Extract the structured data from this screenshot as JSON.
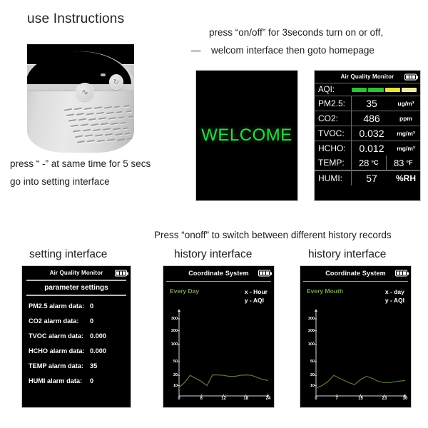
{
  "page": {
    "heading": "use Instructions",
    "instruction_press_line1": "press      “ -” at same time for 5 secs",
    "instruction_press_line2": "go into setting interface",
    "onoff_line1": "press   “on/off”  for 3seconds  turn on or off,",
    "onoff_line2": "welcom  interface  then    goto homepage",
    "onoff_dash": "—",
    "switch_note": "Press   “onoff”   to switch between different history records",
    "caption_setting": "setting interface",
    "caption_history_day": "history  interface",
    "caption_history_month": "history interface"
  },
  "device": {
    "button_left_glyph": "∿",
    "button_right_glyph": "↻"
  },
  "welcome_screen": {
    "text": "WELCOME",
    "color": "#35d24a"
  },
  "monitor_screen": {
    "title": "Air Quality Monitor",
    "aqi": {
      "label": "AQI:",
      "segments": [
        "#2fbf3a",
        "#2fbf3a",
        "#e8e046",
        "#efe9a8"
      ]
    },
    "rows": [
      {
        "label": "PM2.5:",
        "value": "35",
        "unit": "ug/m³"
      },
      {
        "label": "CO2:",
        "value": "486",
        "unit": "ppm"
      },
      {
        "label": "TVOC:",
        "value": "0.032",
        "unit": "mg/m³"
      },
      {
        "label": "HCHO:",
        "value": "0.012",
        "unit": "mg/m³"
      }
    ],
    "temp": {
      "label": "TEMP:",
      "c_value": "28",
      "c_unit": "°C",
      "f_value": "83",
      "f_unit": "°F"
    },
    "humi": {
      "label": "HUMI:",
      "value": "57",
      "unit": "%RH"
    }
  },
  "setting_screen": {
    "title": "Air Quality Monitor",
    "subtitle": "parameter settings",
    "items": [
      {
        "key": "PM2.5 alarm data:",
        "value": "0"
      },
      {
        "key": "CO2 alarm data:",
        "value": "0"
      },
      {
        "key": "TVOC alarm data:",
        "value": "0.000"
      },
      {
        "key": "HCHO alarm data:",
        "value": "0.000"
      },
      {
        "key": "TEMP alarm data:",
        "value": "35"
      },
      {
        "key": "HUMI alarm data:",
        "value": "0"
      }
    ]
  },
  "history_day_screen": {
    "title": "Coordinate System",
    "period": "Every Day",
    "axis_x_label": "x - Hour",
    "axis_y_label": "y - AQI"
  },
  "history_month_screen": {
    "title": "Coordinate System",
    "period": "Every Mouth",
    "axis_x_label": "x - day",
    "axis_y_label": "y - AQI"
  },
  "chart_data": [
    {
      "type": "line",
      "title": "Coordinate System",
      "subtitle": "Every Day",
      "xlabel": "x - Hour",
      "ylabel": "y - AQI",
      "line_color": "#5d7a3e",
      "xticks": [
        "0",
        "6",
        "12",
        "18",
        "24"
      ],
      "xtick_values": [
        0,
        6,
        12,
        18,
        24
      ],
      "yticks": [
        "10",
        "20",
        "50",
        "100",
        "200",
        "300"
      ],
      "ytick_values": [
        10,
        20,
        50,
        100,
        200,
        300
      ],
      "xlim": [
        0,
        24
      ],
      "grid": false,
      "x": [
        0,
        1.5,
        3,
        4.5,
        6,
        7.5,
        9,
        10.5,
        12,
        13.5,
        15,
        16.5,
        18,
        19.5,
        21,
        22.5,
        24
      ],
      "y": [
        8,
        13,
        20,
        17,
        14,
        10,
        21,
        21,
        20,
        19,
        19,
        20,
        21,
        20,
        18,
        16,
        15
      ]
    },
    {
      "type": "line",
      "title": "Coordinate System",
      "subtitle": "Every Mouth",
      "xlabel": "x - day",
      "ylabel": "y - AQI",
      "line_color": "#5d7a3e",
      "xticks": [
        "0",
        "7",
        "15",
        "23",
        "30"
      ],
      "xtick_values": [
        0,
        7,
        15,
        23,
        30
      ],
      "yticks": [
        "10",
        "20",
        "50",
        "100",
        "200",
        "300"
      ],
      "ytick_values": [
        10,
        20,
        50,
        100,
        200,
        300
      ],
      "xlim": [
        0,
        30
      ],
      "grid": false,
      "x": [
        0,
        2,
        4,
        6,
        8,
        11,
        13,
        15,
        17,
        19,
        21,
        23,
        25,
        27,
        30
      ],
      "y": [
        7,
        10,
        14,
        20,
        17,
        13,
        11,
        16,
        19,
        17,
        14,
        13,
        13,
        14,
        15
      ]
    }
  ]
}
